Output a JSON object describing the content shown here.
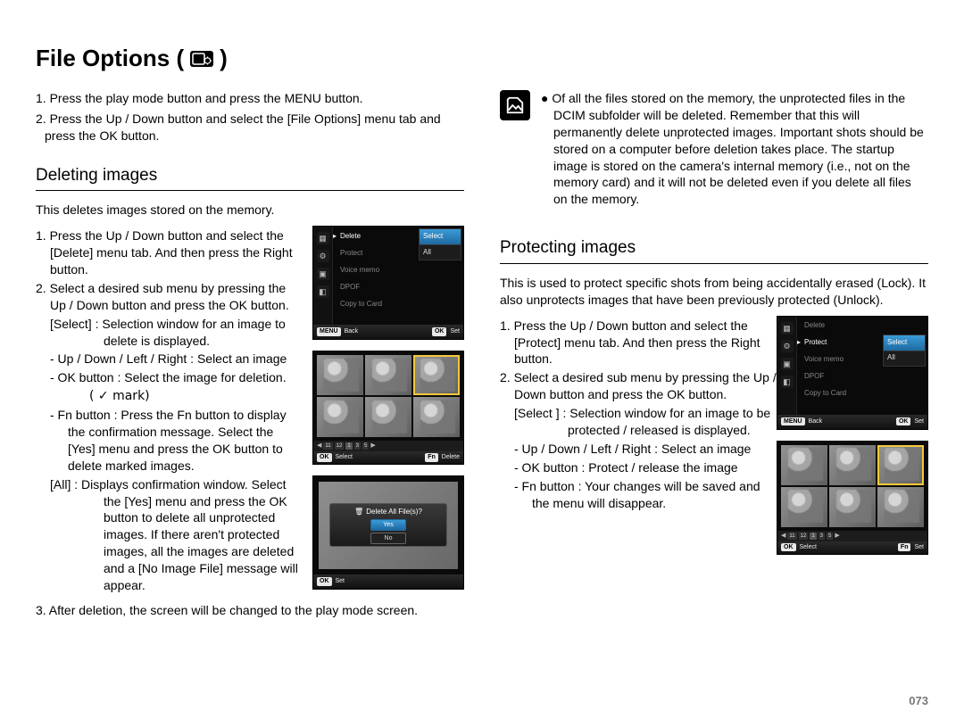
{
  "title": "File Options (",
  "title_close": ")",
  "page_number": "073",
  "intro": {
    "s1": "1. Press the play mode button and press the MENU button.",
    "s2": "2. Press the Up / Down button and select the [File Options] menu tab and press the OK button."
  },
  "deleting": {
    "heading": "Deleting images",
    "lead": "This deletes images stored on the memory.",
    "s1a": "1.  Press the Up / Down button and select the [Delete] menu tab. And then press the Right button.",
    "s2a": "2.  Select a desired sub menu by pressing the Up / Down button and press the OK button.",
    "sel_def": "[Select] :  Selection window for an image to delete is displayed.",
    "udlr": "- Up / Down / Left / Right : Select an image",
    "okb": "- OK button :  Select the image for deletion.",
    "okb2": "( ✓  mark)",
    "fnb": "- Fn button :  Press the Fn button to display the confirmation message. Select the [Yes] menu and press the OK button to delete marked images.",
    "all": "[All] :  Displays confirmation window. Select the [Yes] menu and press the OK button to delete all unprotected images. If there aren't protected images, all the images are deleted and a [No Image File] message will appear.",
    "s3": "3.  After deletion, the screen will be changed to the play mode screen."
  },
  "note": {
    "bullet": "●  Of all the files stored on the memory, the unprotected files in the DCIM subfolder will be deleted. Remember that this will permanently delete unprotected images. Important shots should be stored on a computer before deletion takes place. The startup image is stored on the camera's internal memory (i.e., not on the memory card) and it will not be deleted even if you delete all files on the memory."
  },
  "protecting": {
    "heading": "Protecting images",
    "lead": "This is used to protect specific shots from being accidentally erased (Lock). It also unprotects images that have been previously protected (Unlock).",
    "s1": "1.  Press the Up / Down button and select the [Protect] menu tab. And then press the Right button.",
    "s2": "2.  Select a desired sub menu by pressing the Up / Down button and press the OK button.",
    "sel_def": "[Select ] :  Selection window for an image to be protected / released is displayed.",
    "udlr": "-  Up / Down / Left / Right : Select an image",
    "okb": "-  OK button : Protect / release the image",
    "fnb": "-  Fn button :  Your changes will be saved and the menu will disappear."
  },
  "lcd": {
    "menu": {
      "items": [
        "Delete",
        "Protect",
        "Voice memo",
        "DPOF",
        "Copy to Card"
      ],
      "submenu": [
        "Select",
        "All"
      ],
      "bar_back_key": "MENU",
      "bar_back": "Back",
      "bar_set_key": "OK",
      "bar_set": "Set"
    },
    "thumbs_bar": {
      "pages": [
        "11",
        "12",
        "1",
        "3",
        "5"
      ],
      "select_key": "OK",
      "select": "Select",
      "delete_key": "Fn",
      "delete": "Delete"
    },
    "protect_bar": {
      "select_key": "OK",
      "select": "Select",
      "set_key": "Fn",
      "set": "Set"
    },
    "dialog": {
      "title": "Delete All File(s)?",
      "yes": "Yes",
      "no": "No",
      "bar_key": "OK",
      "bar_set": "Set"
    }
  }
}
